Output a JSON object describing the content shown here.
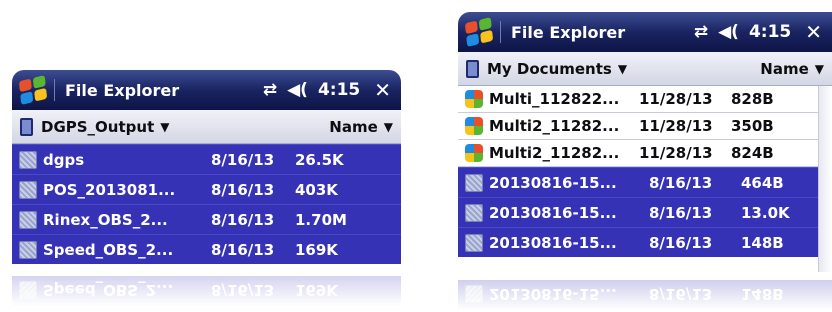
{
  "left_window": {
    "title": "File Explorer",
    "time": "4:15",
    "close": "✕",
    "connectivity_icon": "connectivity-arrows-icon",
    "volume_icon": "speaker-volume-icon",
    "folder": "DGPS_Output",
    "sort": "Name",
    "files": [
      {
        "name": "dgps",
        "date": "8/16/13",
        "size": "26.5K",
        "icon": "generic-file-icon",
        "selected": true
      },
      {
        "name": "POS_2013081...",
        "date": "8/16/13",
        "size": "403K",
        "icon": "generic-file-icon",
        "selected": true
      },
      {
        "name": "Rinex_OBS_2...",
        "date": "8/16/13",
        "size": "1.70M",
        "icon": "generic-file-icon",
        "selected": true
      },
      {
        "name": "Speed_OBS_2...",
        "date": "8/16/13",
        "size": "169K",
        "icon": "generic-file-icon",
        "selected": true
      }
    ]
  },
  "right_window": {
    "title": "File Explorer",
    "time": "4:15",
    "close": "✕",
    "connectivity_icon": "connectivity-arrows-icon",
    "volume_icon": "speaker-volume-icon",
    "folder": "My Documents",
    "sort": "Name",
    "files": [
      {
        "name": "Multi_112822...",
        "date": "11/28/13",
        "size": "828B",
        "icon": "windows-file-icon",
        "selected": false
      },
      {
        "name": "Multi2_11282...",
        "date": "11/28/13",
        "size": "350B",
        "icon": "windows-file-icon",
        "selected": false
      },
      {
        "name": "Multi2_11282...",
        "date": "11/28/13",
        "size": "824B",
        "icon": "windows-file-icon",
        "selected": false
      },
      {
        "name": "20130816-15...",
        "date": "8/16/13",
        "size": "464B",
        "icon": "generic-file-icon",
        "selected": true
      },
      {
        "name": "20130816-15...",
        "date": "8/16/13",
        "size": "13.0K",
        "icon": "generic-file-icon",
        "selected": true
      },
      {
        "name": "20130816-15...",
        "date": "8/16/13",
        "size": "148B",
        "icon": "generic-file-icon",
        "selected": true
      }
    ]
  },
  "colors": {
    "titlebar": "#1a2462",
    "selection": "#3632b6",
    "menubar": "#e2e4ee"
  }
}
